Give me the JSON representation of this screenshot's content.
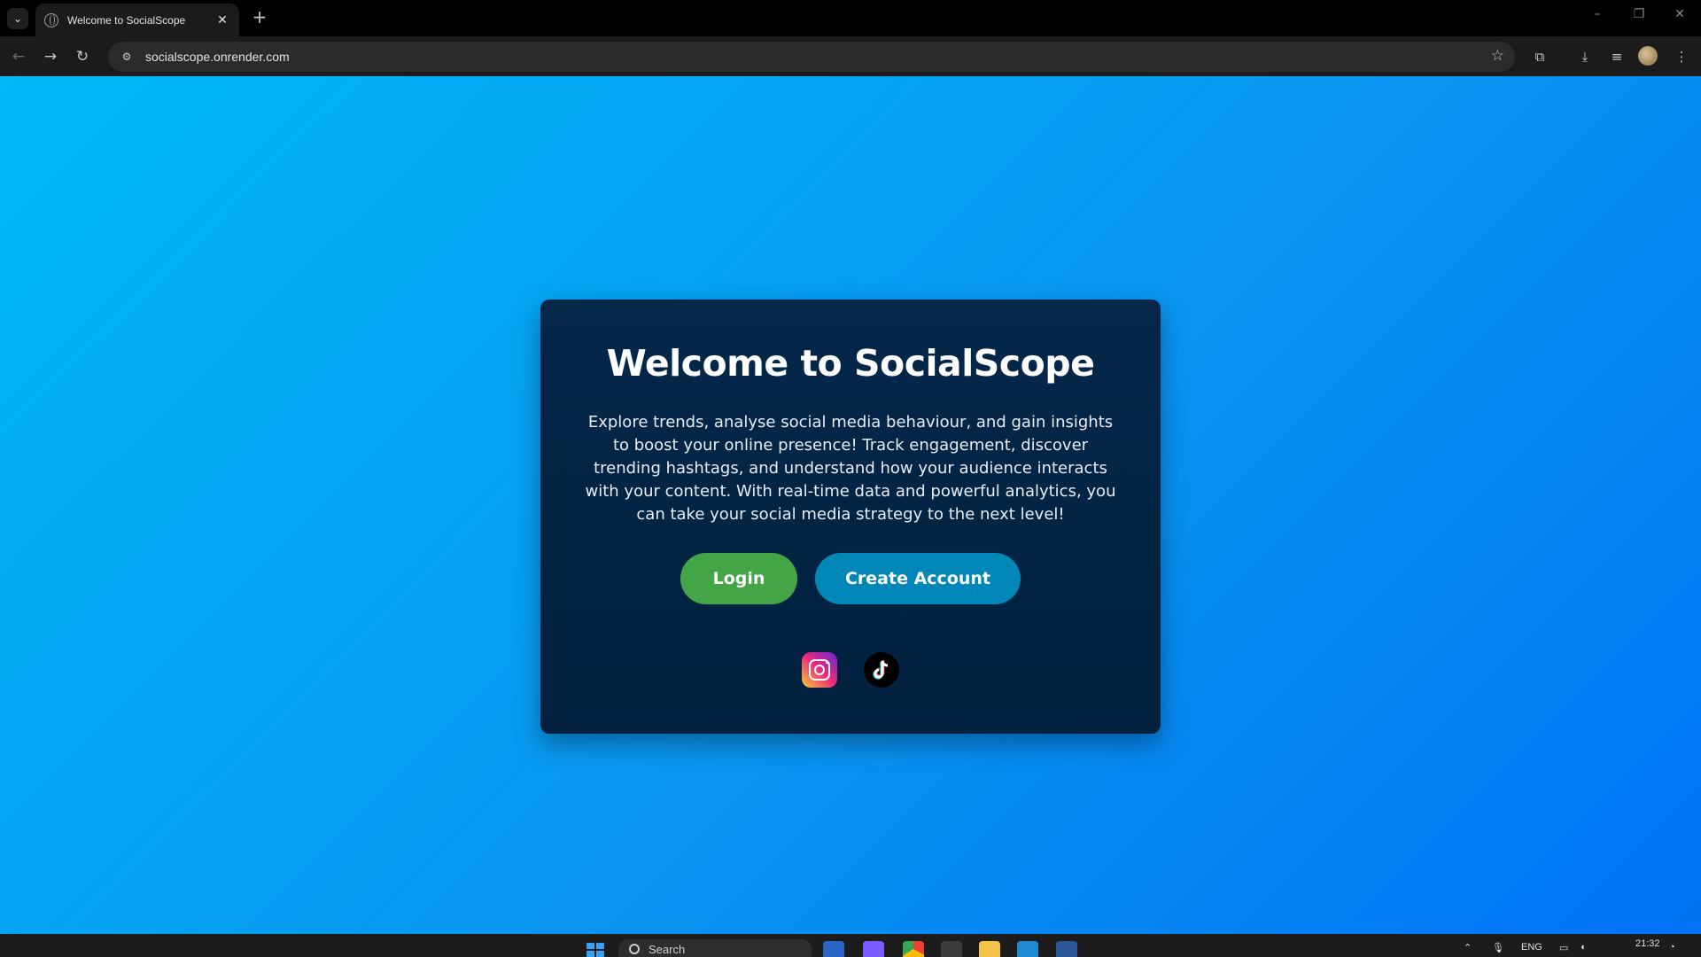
{
  "browser": {
    "tab_title": "Welcome to SocialScope",
    "url": "socialscope.onrender.com",
    "new_tab_label": "+",
    "close_tab_label": "✕"
  },
  "main": {
    "heading": "Welcome to SocialScope",
    "description": "Explore trends, analyse social media behaviour, and gain insights to boost your online presence! Track engagement, discover trending hashtags, and understand how your audience interacts with your content. With real-time data and powerful analytics, you can take your social media strategy to the next level!",
    "login_label": "Login",
    "create_account_label": "Create Account",
    "socials": [
      "instagram-icon",
      "tiktok-icon"
    ]
  },
  "taskbar": {
    "search_placeholder": "Search",
    "language": "ENG",
    "time": "21:32"
  },
  "colors": {
    "page_gradient_start": "#00b7f7",
    "page_gradient_end": "#0072f5",
    "card_bg": "#04274a",
    "login_button": "#43a546",
    "create_button": "#0087b8"
  }
}
